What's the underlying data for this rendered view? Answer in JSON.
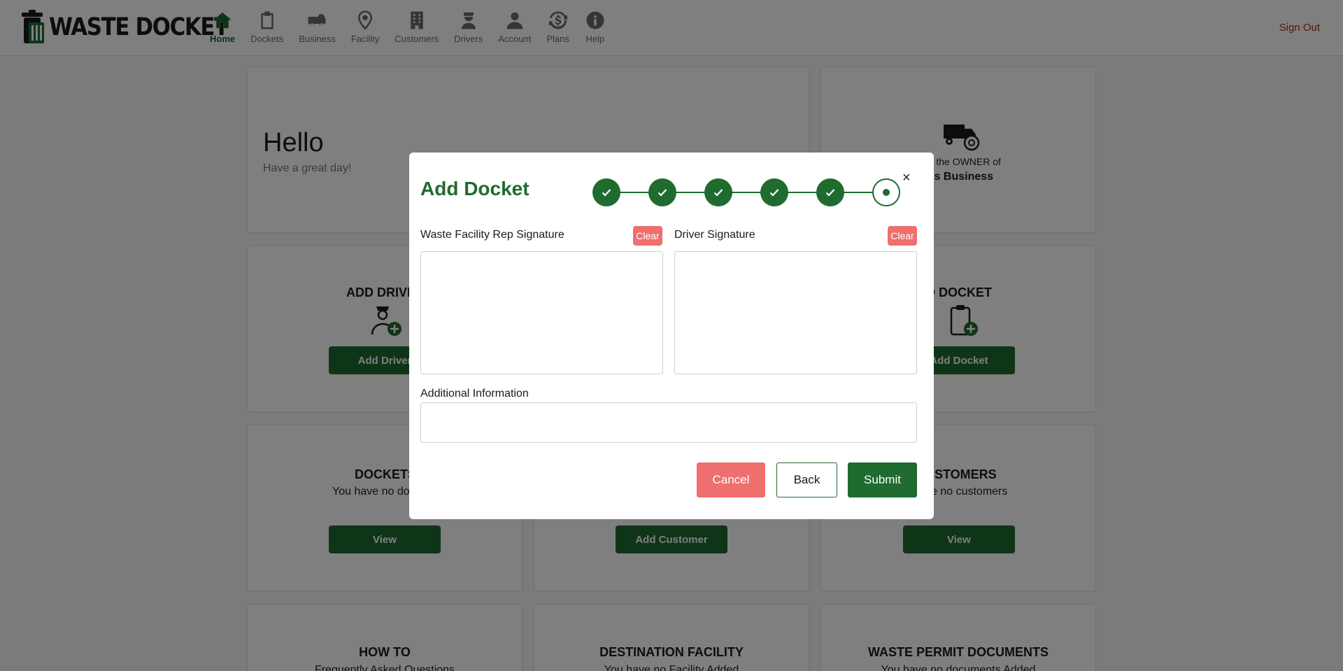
{
  "app": {
    "logo_text": "WASTE DOCKET"
  },
  "nav": {
    "items": [
      {
        "label": "Home",
        "icon": "home-icon",
        "active": true
      },
      {
        "label": "Dockets",
        "icon": "clipboard-icon"
      },
      {
        "label": "Business",
        "icon": "truck-icon"
      },
      {
        "label": "Facility",
        "icon": "location-pin-icon"
      },
      {
        "label": "Customers",
        "icon": "building-icon"
      },
      {
        "label": "Drivers",
        "icon": "driver-icon"
      },
      {
        "label": "Account",
        "icon": "user-icon"
      },
      {
        "label": "Plans",
        "icon": "dollar-cycle-icon"
      },
      {
        "label": "Help",
        "icon": "info-icon"
      }
    ],
    "sign_out": "Sign Out"
  },
  "dashboard": {
    "hello": "Hello",
    "hello_sub": "Have a great day!",
    "owner_text": "re the OWNER of",
    "business_name": "n's Business",
    "add_driver_title": "ADD DRIVE",
    "add_driver_button": "Add Driver",
    "add_docket_title": "D DOCKET",
    "add_docket_button": "Add Docket",
    "dockets_title": "DOCKETS",
    "dockets_text": "You have no do",
    "dockets_button": "View",
    "add_customer_button": "Add Customer",
    "customers_title": "USTOMERS",
    "customers_text": "ve no customers",
    "customers_button": "View",
    "howto_title": "HOW TO",
    "howto_text": "Frequently Asked Questions",
    "facility_title": "DESTINATION FACILITY",
    "facility_text": "You have no Facility Added",
    "permits_title": "WASTE PERMIT DOCUMENTS",
    "permits_text": "You have no documents Added"
  },
  "modal": {
    "title": "Add Docket",
    "close": "×",
    "steps": [
      "done",
      "done",
      "done",
      "done",
      "done",
      "current"
    ],
    "facility_sig_label": "Waste Facility Rep Signature",
    "driver_sig_label": "Driver Signature",
    "clear_label": "Clear",
    "additional_info_label": "Additional Information",
    "additional_info_value": "",
    "cancel": "Cancel",
    "back": "Back",
    "submit": "Submit"
  },
  "colors": {
    "brand_green": "#1f6b30",
    "danger": "#ef6f6f",
    "sign_out": "#b3261e"
  }
}
